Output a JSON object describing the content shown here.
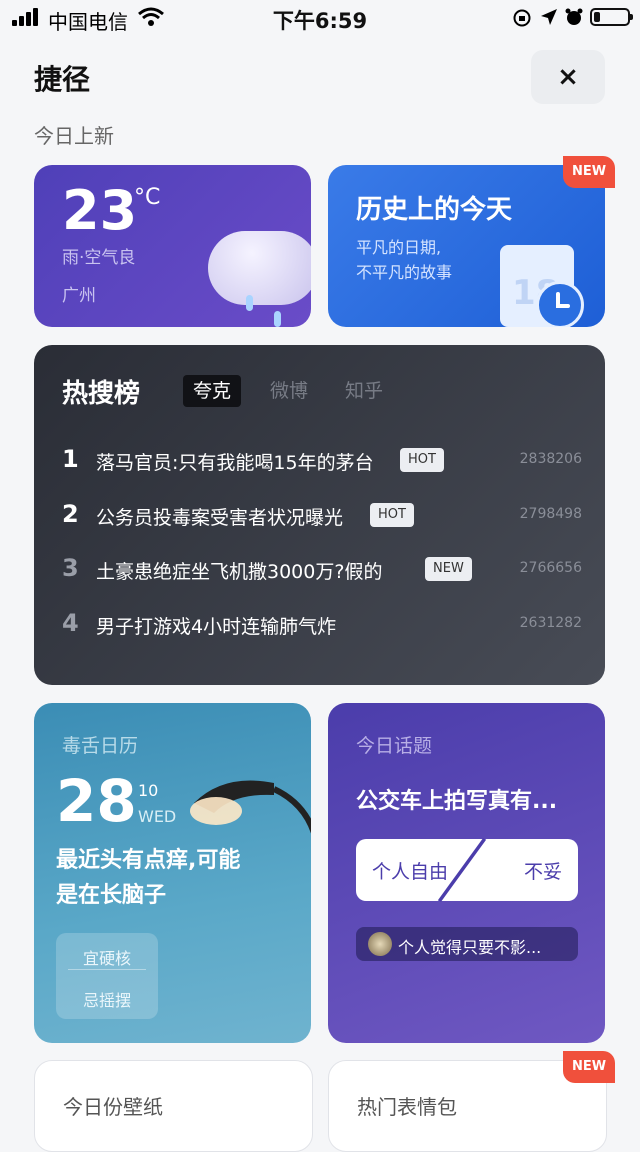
{
  "status_bar": {
    "carrier": "中国电信",
    "time": "下午6:59"
  },
  "header": {
    "title": "捷径",
    "close_glyph": "×"
  },
  "section_today_new": "今日上新",
  "weather": {
    "temp": "23",
    "unit": "°C",
    "condition": "雨·空气良",
    "city": "广州"
  },
  "history": {
    "title": "历史上的今天",
    "subtitle_1": "平凡的日期,",
    "subtitle_2": "不平凡的故事",
    "calendar_number": "18",
    "badge": "NEW"
  },
  "hot_search": {
    "title": "热搜榜",
    "tabs": [
      "夸克",
      "微博",
      "知乎"
    ],
    "items": [
      {
        "rank": "1",
        "text": "落马官员:只有我能喝15年的茅台",
        "tag": "HOT",
        "count": "2838206"
      },
      {
        "rank": "2",
        "text": "公务员投毒案受害者状况曝光",
        "tag": "HOT",
        "count": "2798498"
      },
      {
        "rank": "3",
        "text": "土豪患绝症坐飞机撒3000万?假的",
        "tag": "NEW",
        "count": "2766656"
      },
      {
        "rank": "4",
        "text": "男子打游戏4小时连输肺气炸",
        "tag": "",
        "count": "2631282"
      }
    ]
  },
  "calendar_card": {
    "label": "毒舌日历",
    "day": "28",
    "month": "10",
    "weekday": "WED",
    "quote_1": "最近头有点痒,可能",
    "quote_2": "是在长脑子",
    "advice_do": "宜硬核",
    "advice_dont": "忌摇摆"
  },
  "topic_card": {
    "label": "今日话题",
    "question": "公交车上拍写真有...",
    "option_left": "个人自由",
    "option_right": "不妥",
    "comment": "个人觉得只要不影..."
  },
  "bottom": {
    "wallpaper": "今日份壁纸",
    "emoji": "热门表情包",
    "badge": "NEW"
  }
}
